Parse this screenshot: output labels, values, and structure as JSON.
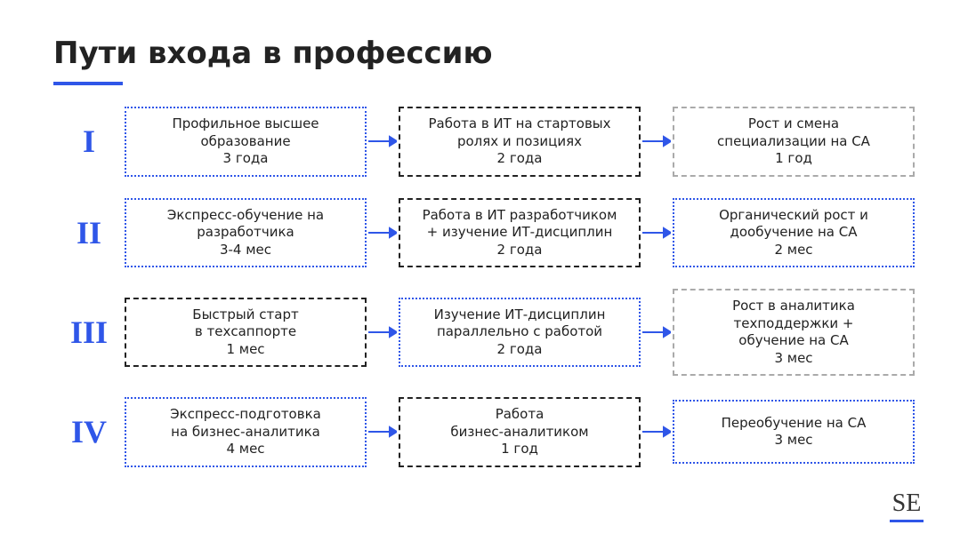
{
  "title": "Пути входа в профессию",
  "footer_tag": "SE",
  "paths": [
    {
      "roman": "I",
      "steps": [
        {
          "text1": "Профильное высшее",
          "text2": "образование",
          "duration": "3 года",
          "style": "blue-dotted"
        },
        {
          "text1": "Работа в ИТ на стартовых",
          "text2": "ролях и позициях",
          "duration": "2 года",
          "style": "black-dashed"
        },
        {
          "text1": "Рост и смена",
          "text2": "специализации на СА",
          "duration": "1 год",
          "style": "gray-dashdot"
        }
      ]
    },
    {
      "roman": "II",
      "steps": [
        {
          "text1": "Экспресс-обучение на",
          "text2": "разработчика",
          "duration": "3-4 мес",
          "style": "blue-dotted"
        },
        {
          "text1": "Работа в ИТ разработчиком",
          "text2": "+ изучение ИТ-дисциплин",
          "duration": "2 года",
          "style": "black-dashed"
        },
        {
          "text1": "Органический рост и",
          "text2": "дообучение на СА",
          "duration": "2 мес",
          "style": "blue-dotted"
        }
      ]
    },
    {
      "roman": "III",
      "steps": [
        {
          "text1": "Быстрый старт",
          "text2": "в техсаппорте",
          "duration": "1 мес",
          "style": "black-dashed"
        },
        {
          "text1": "Изучение ИТ-дисциплин",
          "text2": "параллельно с работой",
          "duration": "2 года",
          "style": "blue-dotted"
        },
        {
          "text1": "Рост в аналитика",
          "text2": "техподдержки +",
          "text3": "обучение на СА",
          "duration": "3 мес",
          "style": "gray-dashdot"
        }
      ]
    },
    {
      "roman": "IV",
      "steps": [
        {
          "text1": "Экспресс-подготовка",
          "text2": "на бизнес-аналитика",
          "duration": "4 мес",
          "style": "blue-dotted"
        },
        {
          "text1": "Работа",
          "text2": "бизнес-аналитиком",
          "duration": "1 год",
          "style": "black-dashed"
        },
        {
          "text1": "Переобучение на СА",
          "text2": "",
          "duration": "3 мес",
          "style": "blue-dotted"
        }
      ]
    }
  ]
}
